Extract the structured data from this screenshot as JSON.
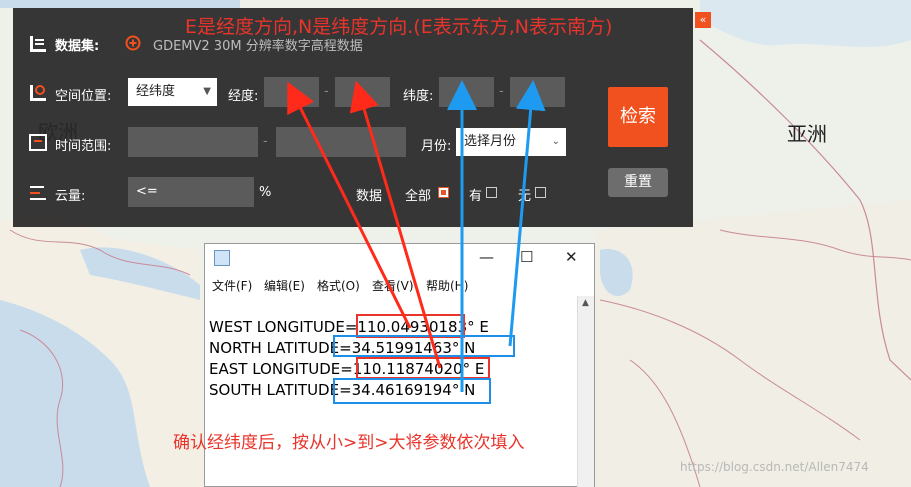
{
  "map": {
    "label_europe": "欧洲",
    "label_asia": "亚洲"
  },
  "annotation": {
    "top_title": "E是经度方向,N是纬度方向.(E表示东方,N表示南方)",
    "bottom_note": "确认经纬度后，按从小>到>大将参数依次填入",
    "watermark": "https://blog.csdn.net/Allen7474"
  },
  "panel": {
    "dataset_label": "数据集:",
    "dataset_value": "GDEMV2 30M 分辨率数字高程数据",
    "spatial_label": "空间位置:",
    "spatial_select": "经纬度",
    "longitude_label": "经度:",
    "latitude_label": "纬度:",
    "time_label": "时间范围:",
    "month_label": "月份:",
    "month_select": "选择月份",
    "cloud_label": "云量:",
    "cloud_placeholder": "<=",
    "cloud_unit": "%",
    "data_label": "数据",
    "opt_all": "全部",
    "opt_yes": "有",
    "opt_no": "无",
    "search_button": "检索",
    "reset_button": "重置",
    "collapse": "«"
  },
  "notepad": {
    "menu": [
      "文件(F)",
      "编辑(E)",
      "格式(O)",
      "查看(V)",
      "帮助(H)"
    ],
    "lines": [
      "WEST LONGITUDE=110.04930183° E",
      "NORTH LATITUDE=34.51991463° N",
      "EAST LONGITUDE=110.11874020° E",
      "SOUTH LATITUDE=34.46169194° N"
    ]
  }
}
